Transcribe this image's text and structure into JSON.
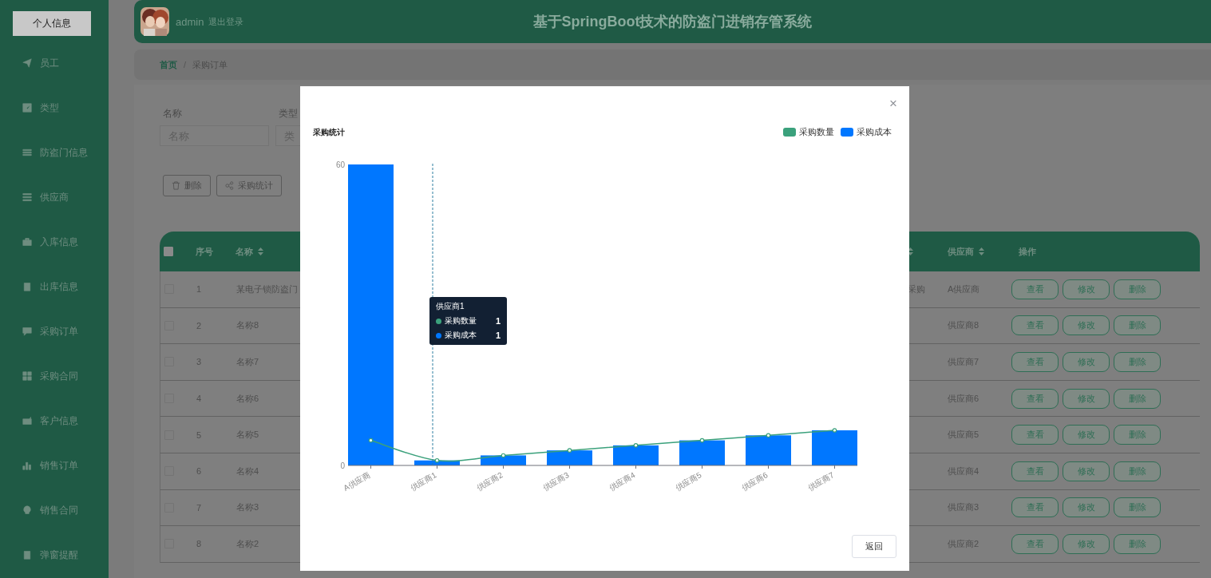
{
  "sidebar": {
    "profile_button": "个人信息",
    "items": [
      {
        "label": "员工"
      },
      {
        "label": "类型"
      },
      {
        "label": "防盗门信息"
      },
      {
        "label": "供应商"
      },
      {
        "label": "入库信息"
      },
      {
        "label": "出库信息"
      },
      {
        "label": "采购订单"
      },
      {
        "label": "采购合同"
      },
      {
        "label": "客户信息"
      },
      {
        "label": "销售订单"
      },
      {
        "label": "销售合同"
      },
      {
        "label": "弹窗提醒"
      }
    ]
  },
  "header": {
    "username": "admin",
    "logout": "退出登录",
    "title": "基于SpringBoot技术的防盗门进销存管系统"
  },
  "breadcrumb": {
    "separator": "/",
    "items": [
      {
        "label": "首页",
        "kind": "link"
      },
      {
        "label": "采购订单",
        "kind": "current"
      }
    ]
  },
  "search": {
    "fields": [
      {
        "label": "名称",
        "placeholder": "名称"
      },
      {
        "label": "类型",
        "placeholder": "类"
      }
    ]
  },
  "actions": [
    {
      "label": "删除",
      "kind": "delete"
    },
    {
      "label": "采购统计",
      "kind": "stats"
    }
  ],
  "table": {
    "all_checked": false,
    "columns": [
      {
        "label": "序号",
        "sortable": false
      },
      {
        "label": "名称",
        "sortable": true
      },
      {
        "sortable": true
      },
      {
        "label": "供应商",
        "sortable": true
      },
      {
        "label": "操作",
        "sortable": false
      }
    ],
    "rows": [
      {
        "checked": false,
        "index": "1",
        "name": "某电子锁防盗门",
        "column_3": "采购",
        "supplier": "A供应商",
        "actions": [
          "查看",
          "修改",
          "删除"
        ]
      },
      {
        "checked": false,
        "index": "2",
        "name": "名称8",
        "supplier": "供应商8",
        "actions": [
          "查看",
          "修改",
          "删除"
        ]
      },
      {
        "checked": false,
        "index": "3",
        "name": "名称7",
        "supplier": "供应商7",
        "actions": [
          "查看",
          "修改",
          "删除"
        ]
      },
      {
        "checked": false,
        "index": "4",
        "name": "名称6",
        "supplier": "供应商6",
        "actions": [
          "查看",
          "修改",
          "删除"
        ]
      },
      {
        "checked": false,
        "index": "5",
        "name": "名称5",
        "supplier": "供应商5",
        "actions": [
          "查看",
          "修改",
          "删除"
        ]
      },
      {
        "checked": false,
        "index": "6",
        "name": "名称4",
        "supplier": "供应商4",
        "actions": [
          "查看",
          "修改",
          "删除"
        ]
      },
      {
        "checked": false,
        "index": "7",
        "name": "名称3",
        "supplier": "供应商3",
        "actions": [
          "查看",
          "修改",
          "删除"
        ]
      },
      {
        "checked": false,
        "index": "8",
        "name": "名称2",
        "supplier": "供应商2",
        "actions": [
          "查看",
          "修改",
          "删除"
        ]
      }
    ]
  },
  "dialog": {
    "close": "×",
    "title": "采购统计",
    "back_button": "返回",
    "chart_data": {
      "type": "bar",
      "categories": [
        "A供应商",
        "供应商1",
        "供应商2",
        "供应商3",
        "供应商4",
        "供应商5",
        "供应商6",
        "供应商7"
      ],
      "ylim": [
        0,
        60
      ],
      "yticks": [
        0,
        60
      ],
      "series": [
        {
          "name": "采购数量",
          "color": "#3ba17c",
          "type": "line",
          "marker": true,
          "values": [
            5,
            1,
            2,
            3,
            4,
            5,
            6,
            7
          ]
        },
        {
          "name": "采购成本",
          "color": "#0077ff",
          "type": "bar",
          "values": [
            60,
            1,
            2,
            3,
            4,
            5,
            6,
            7
          ]
        }
      ]
    },
    "tooltip": {
      "title": "供应商1",
      "rows": [
        {
          "name": "采购数量",
          "value": "1",
          "color": "#3ba17c"
        },
        {
          "name": "采购成本",
          "value": "1",
          "color": "#0077ff"
        }
      ]
    }
  }
}
